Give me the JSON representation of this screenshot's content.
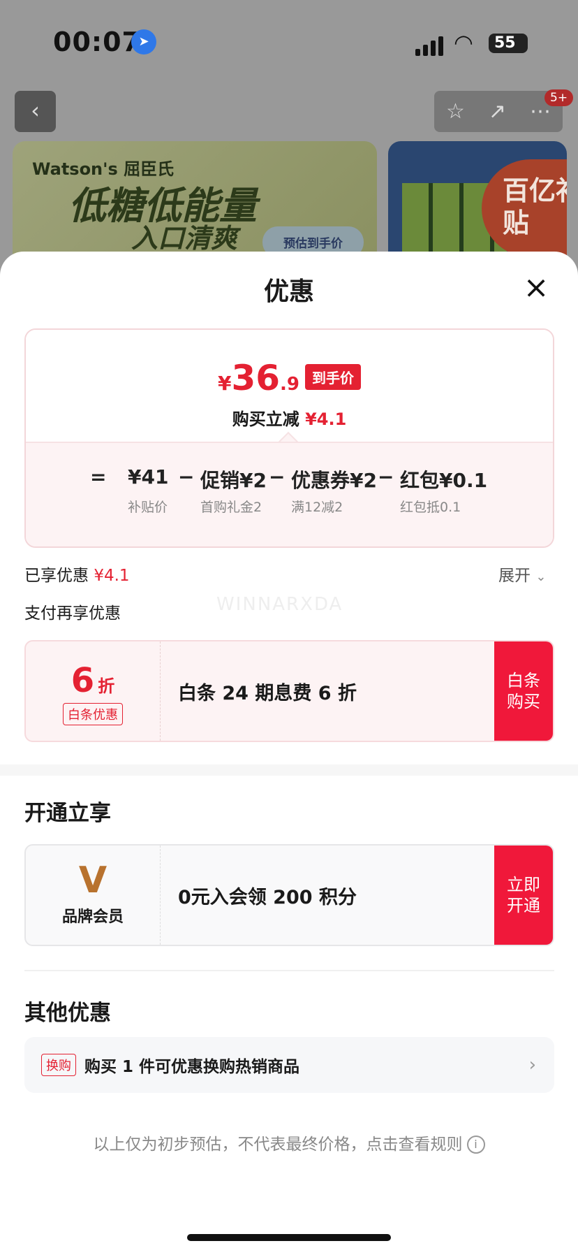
{
  "status_bar": {
    "time": "00:07",
    "battery": "55"
  },
  "background": {
    "brand": "Watson's 屈臣氏",
    "slogan": "低糖低能量",
    "slogan2": "入口清爽",
    "estimate_button": "预估到手价",
    "notification_count": "5+",
    "subsidy_label": "百亿补贴"
  },
  "sheet": {
    "title": "优惠",
    "price": {
      "currency": "¥",
      "main": "36",
      "decimal": ".9",
      "net_tag": "到手价",
      "reduce_label": "购买立减",
      "reduce_value": "¥4.1"
    },
    "calc": [
      {
        "op": "=",
        "value": "¥41",
        "desc": "补贴价"
      },
      {
        "op": "−",
        "value": "促销¥2",
        "desc": "首购礼金2"
      },
      {
        "op": "−",
        "value": "优惠券¥2",
        "desc": "满12减2"
      },
      {
        "op": "−",
        "value": "红包¥0.1",
        "desc": "红包抵0.1"
      }
    ],
    "enjoyed_label": "已享优惠",
    "enjoyed_value": "¥4.1",
    "expand_label": "展开",
    "pay_more_label": "支付再享优惠",
    "watermark": "WINNARXDA",
    "baitiao": {
      "discount_num": "6",
      "discount_unit": "折",
      "tag": "白条优惠",
      "desc": "白条 24 期息费 6 折",
      "button": "白条\n购买"
    },
    "open_title": "开通立享",
    "member": {
      "logo": "V",
      "name": "品牌会员",
      "desc": "0元入会领 200 积分",
      "button": "立即\n开通"
    },
    "other_title": "其他优惠",
    "swap": {
      "tag": "换购",
      "text": "购买 1 件可优惠换购热销商品"
    },
    "footer_note": "以上仅为初步预估，不代表最终价格，点击查看规则"
  },
  "colors": {
    "accent": "#e42132",
    "button_red": "#f0183a",
    "sheet_bg": "#ffffff"
  }
}
